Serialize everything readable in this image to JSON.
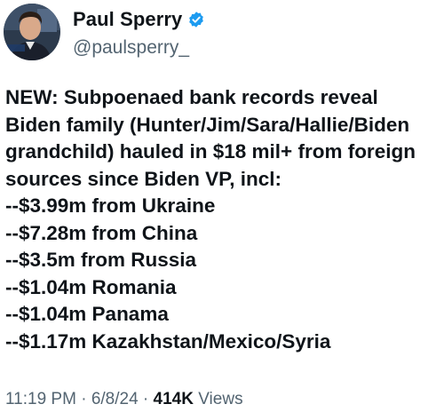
{
  "author": {
    "display_name": "Paul Sperry",
    "handle": "@paulsperry_",
    "verified_color": "#1d9bf0",
    "avatar_icon": "profile-photo"
  },
  "tweet": {
    "lines": [
      "NEW: Subpoenaed bank records reveal",
      "Biden family (Hunter/Jim/Sara/Hallie/Biden",
      "grandchild) hauled in $18 mil+ from foreign",
      "sources since Biden VP, incl:",
      "--$3.99m from Ukraine",
      "--$7.28m from China",
      "--$3.5m from Russia",
      "--$1.04m Romania",
      "--$1.04m Panama",
      "--$1.17m Kazakhstan/Mexico/Syria"
    ]
  },
  "meta": {
    "time": "11:19 PM",
    "separator": " · ",
    "date": "6/8/24",
    "views_count": "414K",
    "views_label": " Views"
  }
}
